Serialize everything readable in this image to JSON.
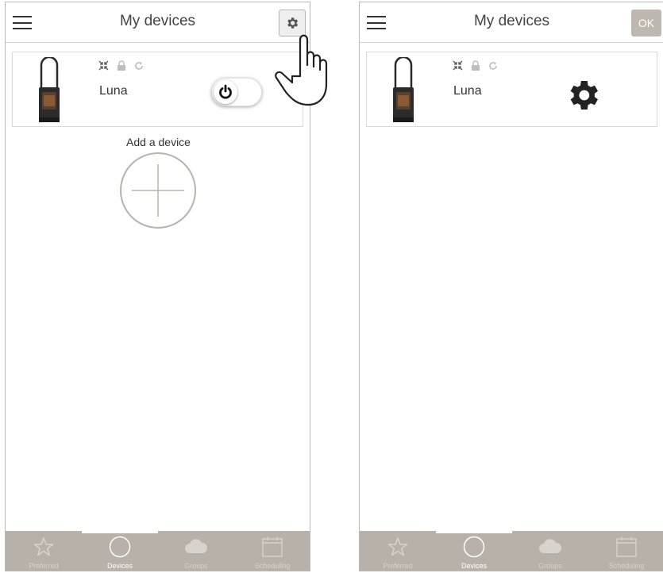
{
  "left_screen": {
    "header": {
      "title": "My devices",
      "settings_icon": "gear-icon"
    },
    "device": {
      "name": "Luna",
      "status_icons": [
        "compress-icon",
        "lock-icon",
        "refresh-icon"
      ],
      "power_toggle": "on"
    },
    "add_device": {
      "label": "Add a device",
      "icon": "plus-icon"
    }
  },
  "right_screen": {
    "header": {
      "title": "My devices",
      "ok_label": "OK"
    },
    "device": {
      "name": "Luna",
      "status_icons": [
        "compress-icon",
        "lock-icon",
        "refresh-icon"
      ],
      "settings_icon": "gear-icon"
    }
  },
  "tabbar": {
    "tabs": [
      {
        "label": "Preferred",
        "icon": "star-icon"
      },
      {
        "label": "Devices",
        "icon": "circle-icon"
      },
      {
        "label": "Groups",
        "icon": "cloud-icon"
      },
      {
        "label": "Scheduling",
        "icon": "calendar-icon"
      }
    ],
    "active_index": 1
  },
  "colors": {
    "tabbar_bg": "#b7b1a9",
    "ok_button_bg": "#bdb8b0",
    "text": "#333333",
    "border": "#d9d9d9"
  }
}
